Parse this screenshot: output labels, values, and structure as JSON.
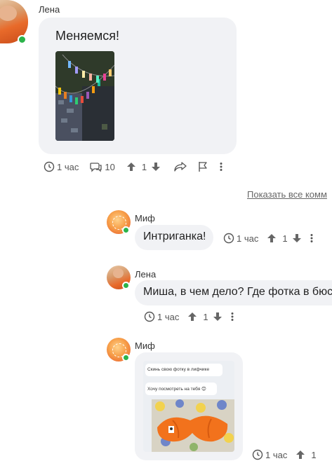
{
  "post": {
    "author": "Лена",
    "text": "Меняемся!",
    "time": "1 час",
    "replies_count": "10",
    "rating": "1"
  },
  "show_all_link": "Показать все комм",
  "comments": [
    {
      "author": "Миф",
      "text": "Интриганка!",
      "time": "1 час",
      "rating": "1"
    },
    {
      "author": "Лена",
      "text": "Миша, в чем дело? Где фотка в бюс",
      "time": "1 час",
      "rating": "1"
    },
    {
      "author": "Миф",
      "screenshot_bubbles": [
        "Скинь свою фотку в лифчике",
        "Хочу посмотреть на тебя 😊"
      ],
      "time": "1 час",
      "rating": "1"
    }
  ],
  "icons": [
    "clock-icon",
    "replies-icon",
    "upvote-icon",
    "downvote-icon",
    "share-icon",
    "flag-icon",
    "more-icon"
  ],
  "colors": {
    "bubble": "#f1f2f5",
    "online": "#2bb34a",
    "accent_orange": "#f2721c"
  }
}
